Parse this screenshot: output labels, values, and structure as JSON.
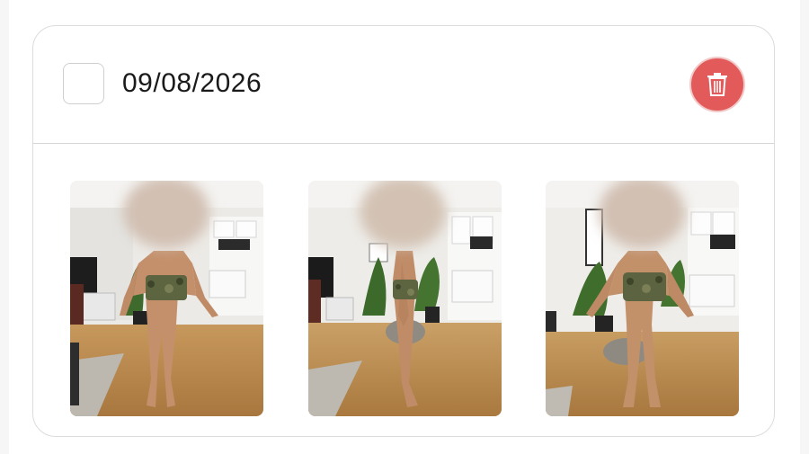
{
  "entry": {
    "date": "09/08/2026",
    "selected": false,
    "delete_icon": "trash-icon"
  },
  "colors": {
    "delete_button": "#e25a5a",
    "card_border": "#dcdcdc",
    "divider": "#d6d6d6",
    "text": "#1a1a1a"
  },
  "photos": [
    {
      "view": "front",
      "icon": "photo-thumbnail"
    },
    {
      "view": "side",
      "icon": "photo-thumbnail"
    },
    {
      "view": "back",
      "icon": "photo-thumbnail"
    }
  ]
}
